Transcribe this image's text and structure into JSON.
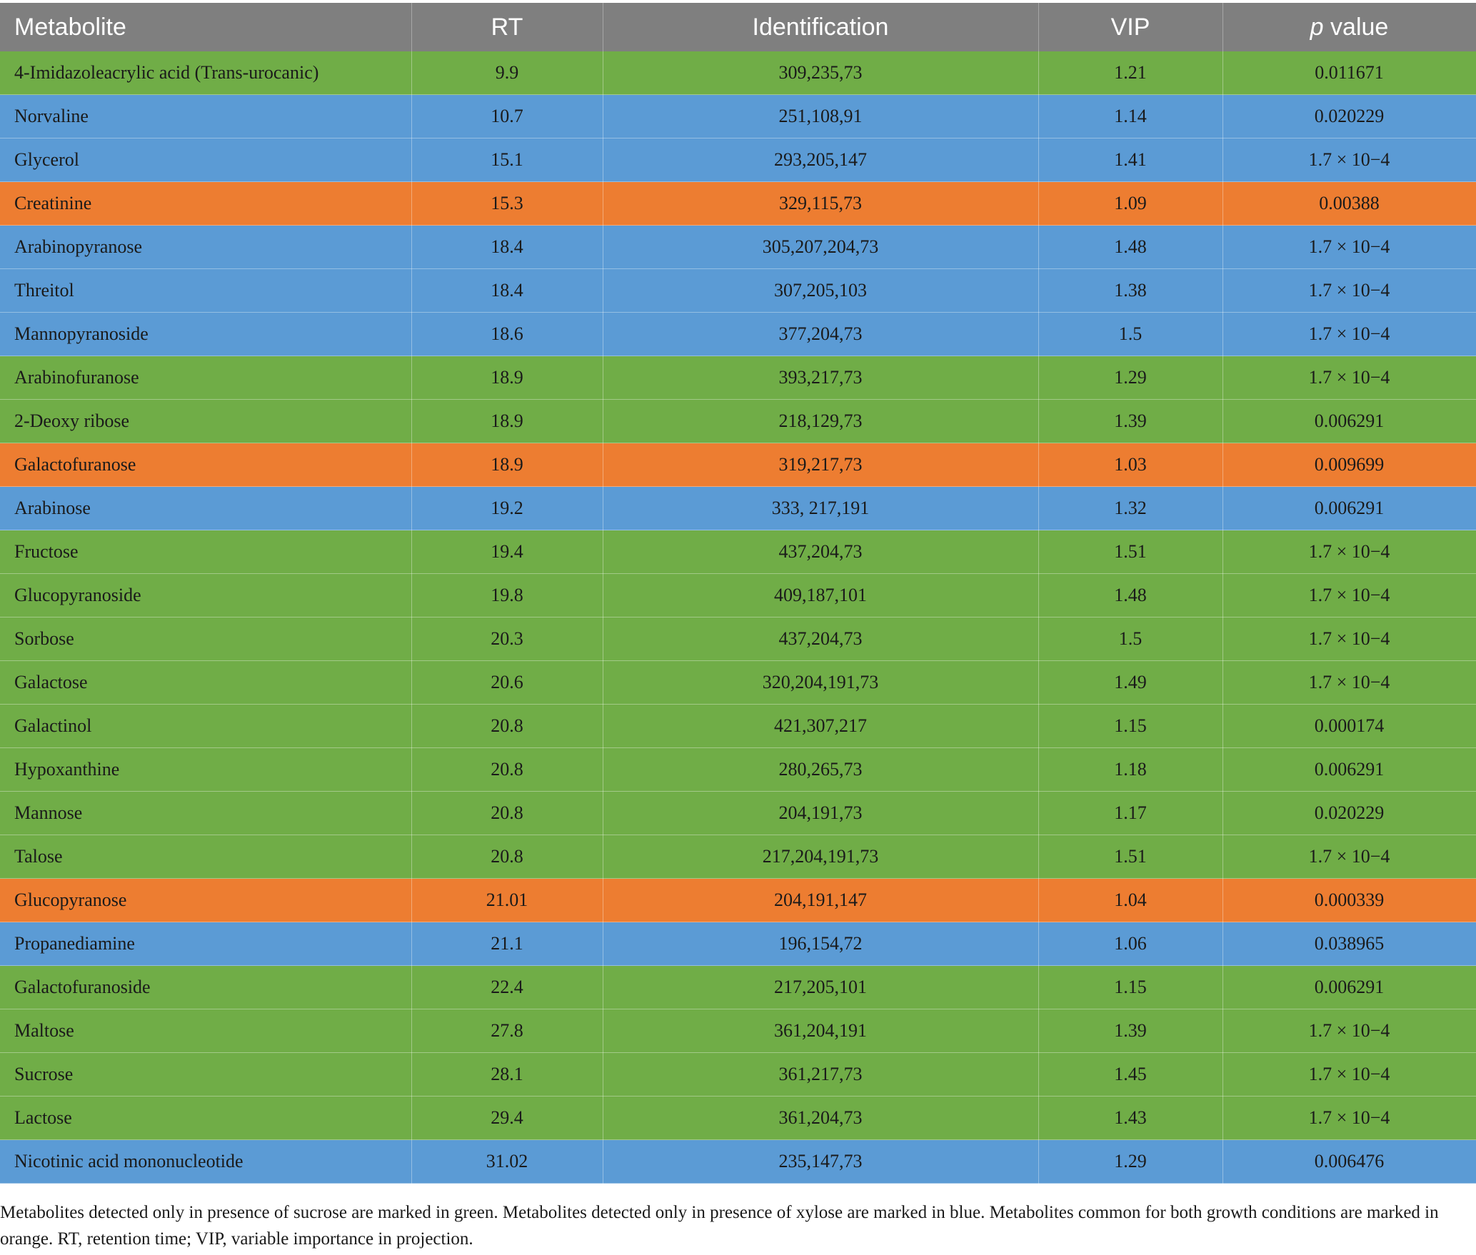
{
  "table": {
    "headers": [
      "Metabolite",
      "RT",
      "Identification",
      "VIP",
      "p",
      " value"
    ],
    "rows": [
      {
        "metabolite": "4-Imidazoleacrylic acid (Trans-urocanic)",
        "rt": "9.9",
        "identification": "309,235,73",
        "vip": "1.21",
        "p_value": "0.011671",
        "group": "green"
      },
      {
        "metabolite": "Norvaline",
        "rt": "10.7",
        "identification": "251,108,91",
        "vip": "1.14",
        "p_value": "0.020229",
        "group": "blue"
      },
      {
        "metabolite": "Glycerol",
        "rt": "15.1",
        "identification": "293,205,147",
        "vip": "1.41",
        "p_value": "1.7 × 10−4",
        "group": "blue"
      },
      {
        "metabolite": "Creatinine",
        "rt": "15.3",
        "identification": "329,115,73",
        "vip": "1.09",
        "p_value": "0.00388",
        "group": "orange"
      },
      {
        "metabolite": "Arabinopyranose",
        "rt": "18.4",
        "identification": "305,207,204,73",
        "vip": "1.48",
        "p_value": "1.7 × 10−4",
        "group": "blue"
      },
      {
        "metabolite": "Threitol",
        "rt": "18.4",
        "identification": "307,205,103",
        "vip": "1.38",
        "p_value": "1.7 × 10−4",
        "group": "blue"
      },
      {
        "metabolite": "Mannopyranoside",
        "rt": "18.6",
        "identification": "377,204,73",
        "vip": "1.5",
        "p_value": "1.7 × 10−4",
        "group": "blue"
      },
      {
        "metabolite": "Arabinofuranose",
        "rt": "18.9",
        "identification": "393,217,73",
        "vip": "1.29",
        "p_value": "1.7 × 10−4",
        "group": "green"
      },
      {
        "metabolite": "2-Deoxy ribose",
        "rt": "18.9",
        "identification": "218,129,73",
        "vip": "1.39",
        "p_value": "0.006291",
        "group": "green"
      },
      {
        "metabolite": "Galactofuranose",
        "rt": "18.9",
        "identification": "319,217,73",
        "vip": "1.03",
        "p_value": "0.009699",
        "group": "orange"
      },
      {
        "metabolite": "Arabinose",
        "rt": "19.2",
        "identification": "333, 217,191",
        "vip": "1.32",
        "p_value": "0.006291",
        "group": "blue"
      },
      {
        "metabolite": "Fructose",
        "rt": "19.4",
        "identification": "437,204,73",
        "vip": "1.51",
        "p_value": "1.7 × 10−4",
        "group": "green"
      },
      {
        "metabolite": "Glucopyranoside",
        "rt": "19.8",
        "identification": "409,187,101",
        "vip": "1.48",
        "p_value": "1.7 × 10−4",
        "group": "green"
      },
      {
        "metabolite": "Sorbose",
        "rt": "20.3",
        "identification": "437,204,73",
        "vip": "1.5",
        "p_value": "1.7 × 10−4",
        "group": "green"
      },
      {
        "metabolite": "Galactose",
        "rt": "20.6",
        "identification": "320,204,191,73",
        "vip": "1.49",
        "p_value": "1.7 × 10−4",
        "group": "green"
      },
      {
        "metabolite": "Galactinol",
        "rt": "20.8",
        "identification": "421,307,217",
        "vip": "1.15",
        "p_value": "0.000174",
        "group": "green"
      },
      {
        "metabolite": "Hypoxanthine",
        "rt": "20.8",
        "identification": "280,265,73",
        "vip": "1.18",
        "p_value": "0.006291",
        "group": "green"
      },
      {
        "metabolite": "Mannose",
        "rt": "20.8",
        "identification": "204,191,73",
        "vip": "1.17",
        "p_value": "0.020229",
        "group": "green"
      },
      {
        "metabolite": "Talose",
        "rt": "20.8",
        "identification": "217,204,191,73",
        "vip": "1.51",
        "p_value": "1.7 × 10−4",
        "group": "green"
      },
      {
        "metabolite": "Glucopyranose",
        "rt": "21.01",
        "identification": "204,191,147",
        "vip": "1.04",
        "p_value": "0.000339",
        "group": "orange"
      },
      {
        "metabolite": "Propanediamine",
        "rt": "21.1",
        "identification": "196,154,72",
        "vip": "1.06",
        "p_value": "0.038965",
        "group": "blue"
      },
      {
        "metabolite": "Galactofuranoside",
        "rt": "22.4",
        "identification": "217,205,101",
        "vip": "1.15",
        "p_value": "0.006291",
        "group": "green"
      },
      {
        "metabolite": "Maltose",
        "rt": "27.8",
        "identification": "361,204,191",
        "vip": "1.39",
        "p_value": "1.7 × 10−4",
        "group": "green"
      },
      {
        "metabolite": "Sucrose",
        "rt": "28.1",
        "identification": "361,217,73",
        "vip": "1.45",
        "p_value": "1.7 × 10−4",
        "group": "green"
      },
      {
        "metabolite": "Lactose",
        "rt": "29.4",
        "identification": "361,204,73",
        "vip": "1.43",
        "p_value": "1.7 × 10−4",
        "group": "green"
      },
      {
        "metabolite": "Nicotinic acid mononucleotide",
        "rt": "31.02",
        "identification": "235,147,73",
        "vip": "1.29",
        "p_value": "0.006476",
        "group": "blue"
      }
    ]
  },
  "footnote": "Metabolites detected only in presence of sucrose are marked in green. Metabolites detected only in presence of xylose are marked in blue. Metabolites common for both growth conditions are marked in orange. RT, retention time; VIP, variable importance in projection.",
  "colors": {
    "header": "#7f7f7f",
    "green": "#70ad47",
    "blue": "#5b9bd5",
    "orange": "#ed7d31"
  }
}
